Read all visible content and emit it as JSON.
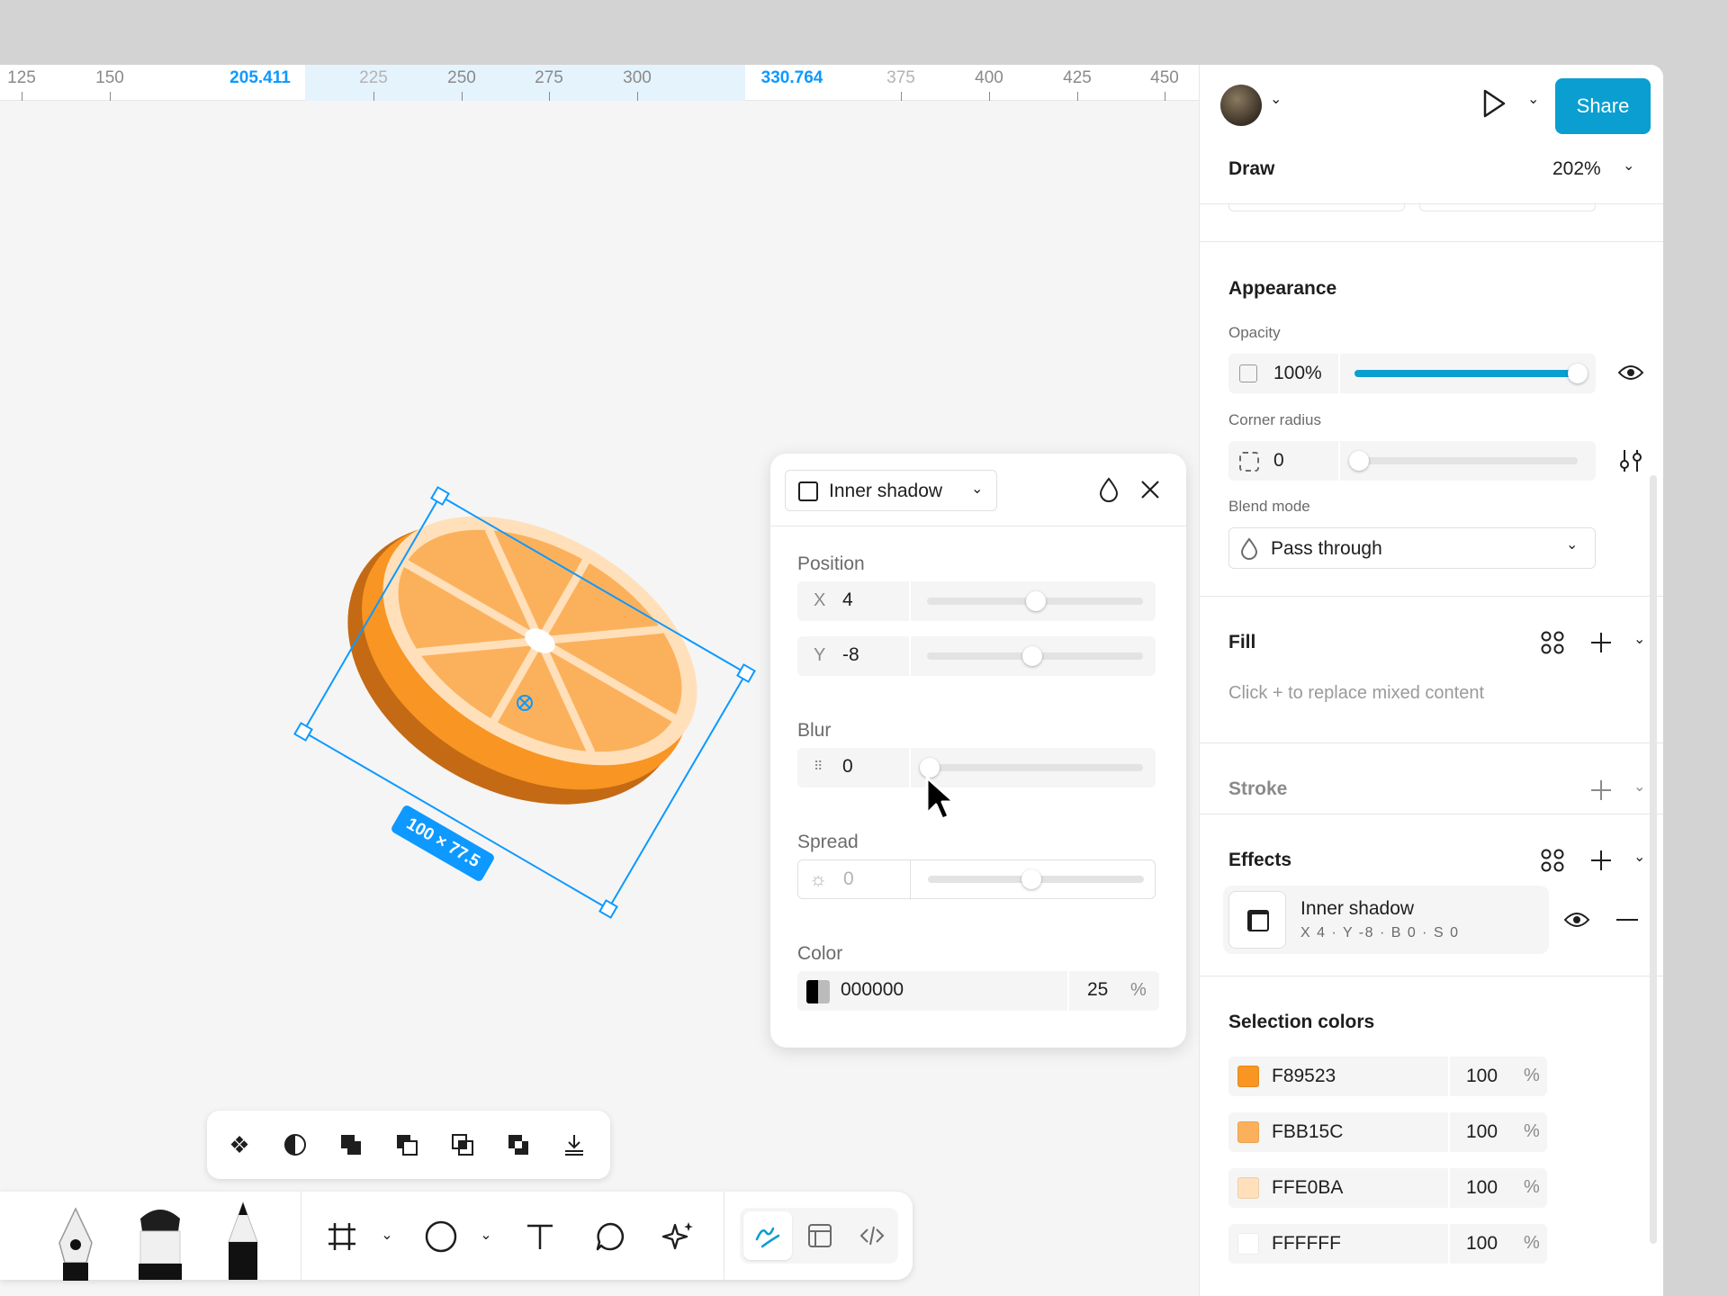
{
  "ruler": {
    "ticks": [
      "125",
      "150",
      "225",
      "250",
      "275",
      "300",
      "375",
      "400",
      "425",
      "450"
    ],
    "selection_start": "205.411",
    "selection_end": "330.764"
  },
  "canvas": {
    "size_badge": "100 × 77.5"
  },
  "header": {
    "share_label": "Share",
    "mode_label": "Draw",
    "zoom": "202%"
  },
  "appearance": {
    "title": "Appearance",
    "opacity_label": "Opacity",
    "opacity_value": "100%",
    "opacity_level": 1.0,
    "corner_radius_label": "Corner radius",
    "corner_radius_value": "0",
    "blend_mode_label": "Blend mode",
    "blend_mode_value": "Pass through"
  },
  "fill": {
    "title": "Fill",
    "placeholder": "Click + to replace mixed content"
  },
  "stroke": {
    "title": "Stroke"
  },
  "effects": {
    "title": "Effects",
    "item_name": "Inner shadow",
    "item_detail": "X 4 · Y -8 · B 0 · S 0"
  },
  "selection_colors": {
    "title": "Selection colors",
    "items": [
      {
        "hex": "F89523",
        "opacity": "100",
        "color": "#F89523"
      },
      {
        "hex": "FBB15C",
        "opacity": "100",
        "color": "#FBB15C"
      },
      {
        "hex": "FFE0BA",
        "opacity": "100",
        "color": "#FFE0BA"
      },
      {
        "hex": "FFFFFF",
        "opacity": "100",
        "color": "#FFFFFF"
      }
    ],
    "pct_sign": "%"
  },
  "popover": {
    "effect_type": "Inner shadow",
    "position_label": "Position",
    "x_prefix": "X",
    "x_value": "4",
    "y_prefix": "Y",
    "y_value": "-8",
    "blur_label": "Blur",
    "blur_value": "0",
    "spread_label": "Spread",
    "spread_value": "0",
    "color_label": "Color",
    "color_hex": "000000",
    "color_opacity": "25",
    "pct_sign": "%"
  },
  "colors": {
    "accent": "#0D99FF",
    "share_button": "#0A9ED1",
    "orange_dark": "#C46A14",
    "orange": "#F89523",
    "orange_light": "#FBB15C",
    "pith": "#FFE0BA"
  }
}
